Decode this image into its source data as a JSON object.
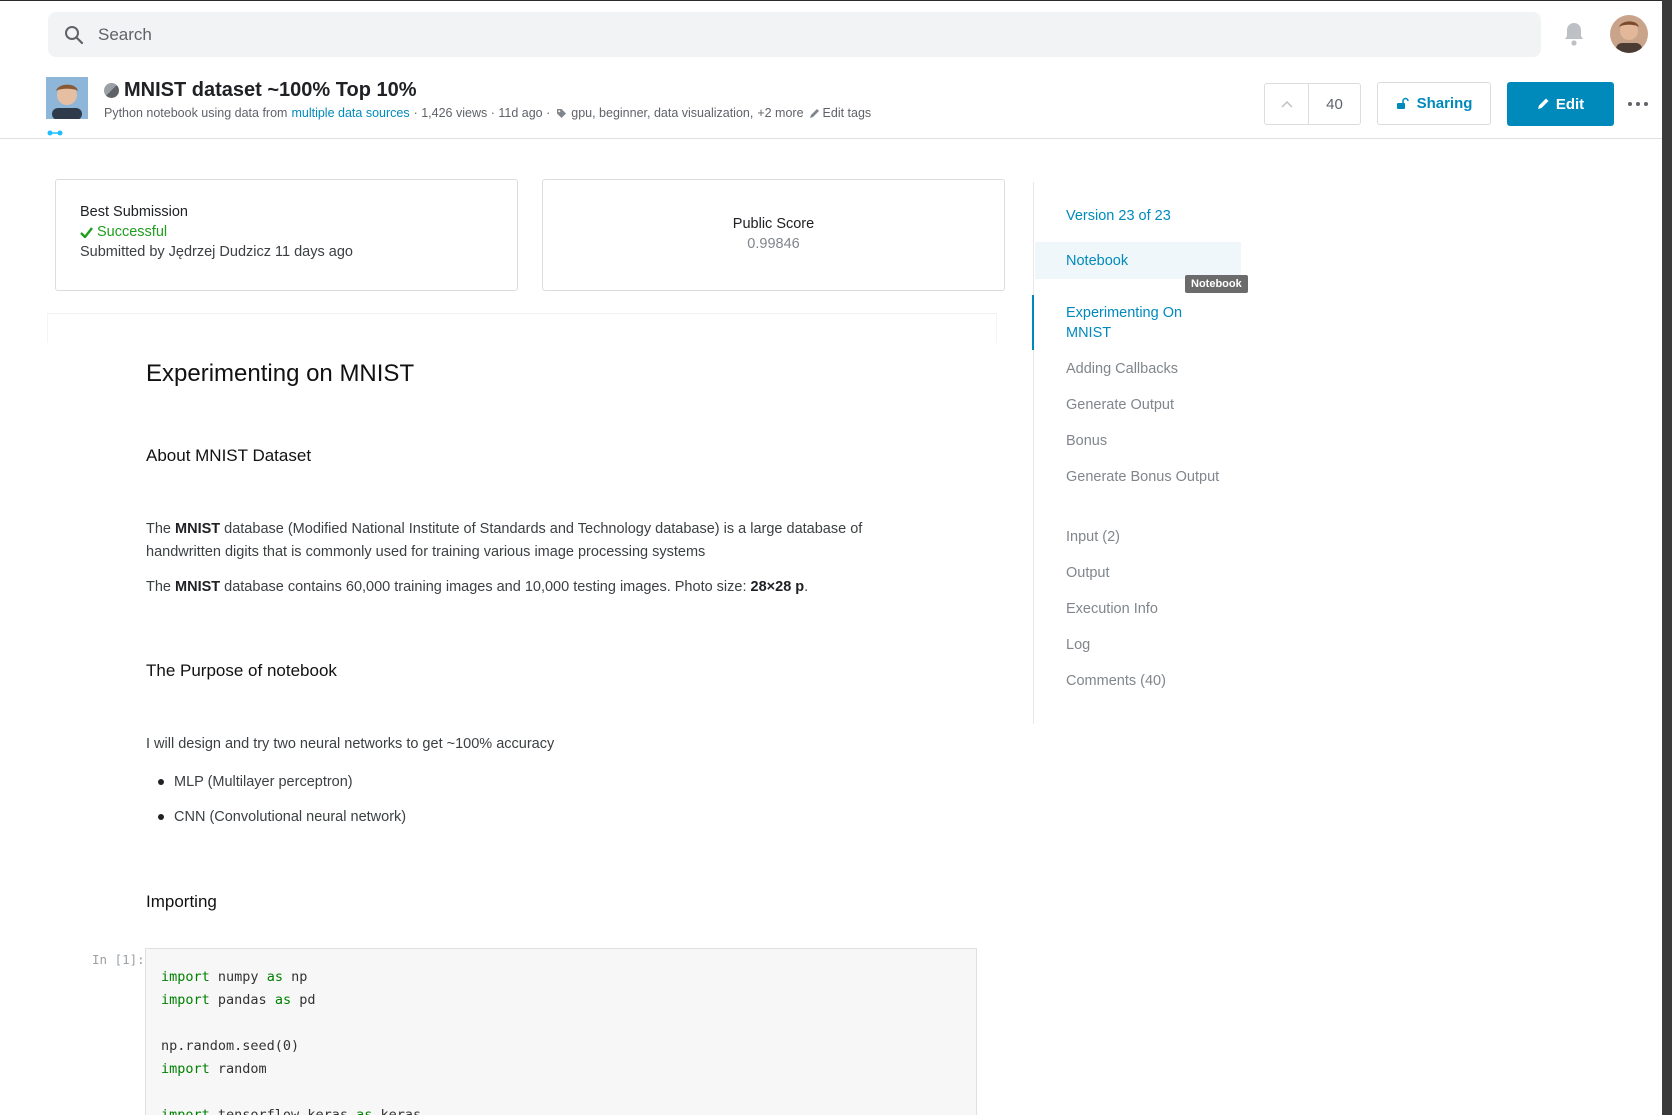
{
  "search": {
    "placeholder": "Search"
  },
  "header": {
    "title": "MNIST dataset ~100% Top 10%",
    "meta_prefix": "Python notebook using data from",
    "meta_link": "multiple data sources",
    "meta_stats": "· 1,426 views · 11d ago ·",
    "tags": "gpu, beginner, data visualization,",
    "tags_more": "+2 more",
    "edit_tags": "Edit tags",
    "vote_count": "40",
    "sharing_label": "Sharing",
    "edit_label": "Edit"
  },
  "best_submission": {
    "label": "Best Submission",
    "status": "Successful",
    "submitted": "Submitted by Jędrzej Dudzicz 11 days ago"
  },
  "public_score": {
    "label": "Public Score",
    "value": "0.99846"
  },
  "notebook": {
    "h1": "Experimenting on MNIST",
    "about_heading": "About MNIST Dataset",
    "para1_pre": "The ",
    "para1_bold": "MNIST",
    "para1_post": " database (Modified National Institute of Standards and Technology database) is a large database of handwritten digits that is commonly used for training various image processing systems",
    "para2_pre": "The ",
    "para2_bold": "MNIST",
    "para2_mid": " database contains 60,000 training images and 10,000 testing images. Photo size: ",
    "para2_bold2": "28×28 p",
    "para2_end": ".",
    "purpose_heading": "The Purpose of notebook",
    "purpose_text": "I will design and try two neural networks to get ~100% accuracy",
    "bullets": [
      "MLP (Multilayer perceptron)",
      "CNN (Convolutional neural network)"
    ],
    "importing_heading": "Importing",
    "in_label": "In [1]:",
    "code": {
      "l1_kw": "import",
      "l1_rest": " numpy ",
      "l1_kw2": "as",
      "l1_end": " np",
      "l2_kw": "import",
      "l2_rest": " pandas ",
      "l2_kw2": "as",
      "l2_end": " pd",
      "l4": "np.random.seed(0)",
      "l5_kw": "import",
      "l5_rest": " random",
      "l7_kw": "import",
      "l7_rest": " tensorflow.keras ",
      "l7_kw2": "as",
      "l7_end": " keras"
    }
  },
  "toc": {
    "version": "Version 23 of 23",
    "notebook": "Notebook",
    "tooltip": "Notebook",
    "items": [
      "Experimenting On MNIST",
      "Adding Callbacks",
      "Generate Output",
      "Bonus",
      "Generate Bonus Output"
    ],
    "sections": [
      "Input (2)",
      "Output",
      "Execution Info",
      "Log",
      "Comments (40)"
    ]
  },
  "colors": {
    "accent": "#008abc",
    "success": "#1e9e1e",
    "code_keyword": "#008000"
  }
}
